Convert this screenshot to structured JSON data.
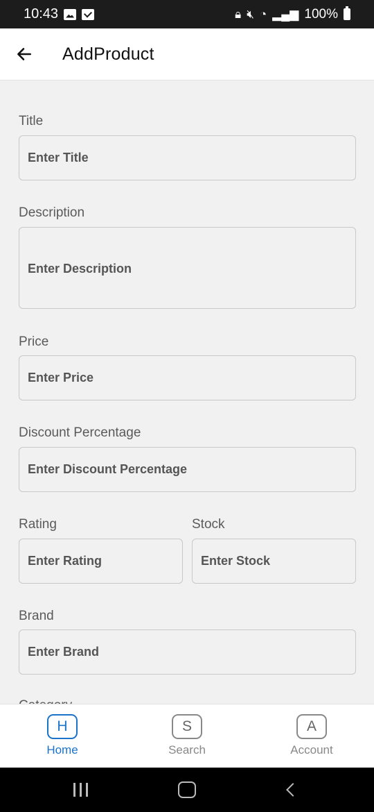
{
  "status_bar": {
    "time": "10:43",
    "battery": "100%"
  },
  "app_bar": {
    "title": "AddProduct"
  },
  "form": {
    "title": {
      "label": "Title",
      "placeholder": "Enter Title"
    },
    "description": {
      "label": "Description",
      "placeholder": "Enter Description"
    },
    "price": {
      "label": "Price",
      "placeholder": "Enter Price"
    },
    "discount": {
      "label": "Discount Percentage",
      "placeholder": "Enter Discount Percentage"
    },
    "rating": {
      "label": "Rating",
      "placeholder": "Enter Rating"
    },
    "stock": {
      "label": "Stock",
      "placeholder": "Enter Stock"
    },
    "brand": {
      "label": "Brand",
      "placeholder": "Enter Brand"
    },
    "category": {
      "label": "Category"
    }
  },
  "bottom_nav": {
    "items": [
      {
        "letter": "H",
        "label": "Home",
        "active": true
      },
      {
        "letter": "S",
        "label": "Search",
        "active": false
      },
      {
        "letter": "A",
        "label": "Account",
        "active": false
      }
    ],
    "active_color": "#1a73c9"
  }
}
